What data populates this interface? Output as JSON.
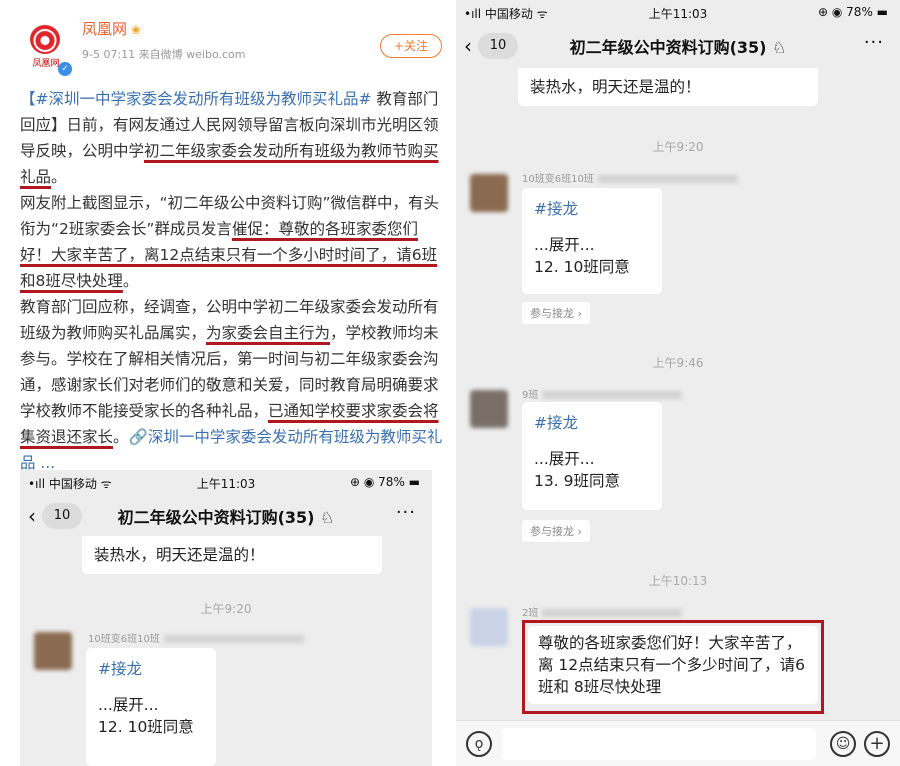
{
  "weibo": {
    "logo_text": "凤凰网",
    "name": "凤凰网",
    "badge": "❀",
    "meta": "9-5 07:11  来自微博 weibo.com",
    "follow": "+关注",
    "text": {
      "p1_link": "【#深圳一中学家委会发动所有班级为教师买礼品#",
      "p1_a": " 教育部门回应】日前，有网友通过人民网领导留言板向深圳市光明区领导反映，公明中学",
      "p1_ul": "初二年级家委会发动所有班级为教师节购买礼品",
      "p1_end": "。",
      "p2_a": "网友附上截图显示，“初二年级公中资料订购”微信群中，有头衔为“2班家委会长”群成员发言",
      "p2_ul": "催促：尊敬的各班家委您们好！大家辛苦了，离12点结束只有一个多小时时间了，请6班和8班尽快处理",
      "p2_end": "。",
      "p3_a": "教育部门回应称，经调查，公明中学初二年级家委会发动所有班级为教师购买礼品属实，",
      "p3_ul1": "为家委会自主行为",
      "p3_b": "，学校教师均未参与。学校在了解相关情况后，第一时间与初二年级家委会沟通，感谢家长们对老师们的敬意和关爱，同时教育局明确要求学校教师不能接受家长的各种礼品，",
      "p3_ul2": "已通知学校要求家委会将集资退还家长",
      "p3_c": "。",
      "p3_link": "🔗深圳一中学家委会发动所有班级为教师买礼品 ..."
    }
  },
  "phone": {
    "carrier": "•ıll 中国移动 ᯤ",
    "time": "上午11:03",
    "battery": "⊕ ◉ 78% ▬",
    "back_count": "10",
    "title": "初二年级公中资料订购(35) ♘",
    "more": "···",
    "msg_hot_water": "装热水，明天还是温的！",
    "time_920": "上午9:20",
    "sender1": "10班变6班10班",
    "jielong_tag": "#接龙",
    "expand": "...展开...",
    "reply1": "12. 10班同意",
    "join_jielong": "参与接龙 ›",
    "time_946": "上午9:46",
    "sender2": "9班",
    "reply2": "13. 9班同意",
    "time_1013": "上午10:13",
    "sender3": "2班",
    "final_msg": "尊敬的各班家委您们好！大家辛苦了，离 12点结束只有一个多少时间了，请6班和 8班尽快处理"
  }
}
